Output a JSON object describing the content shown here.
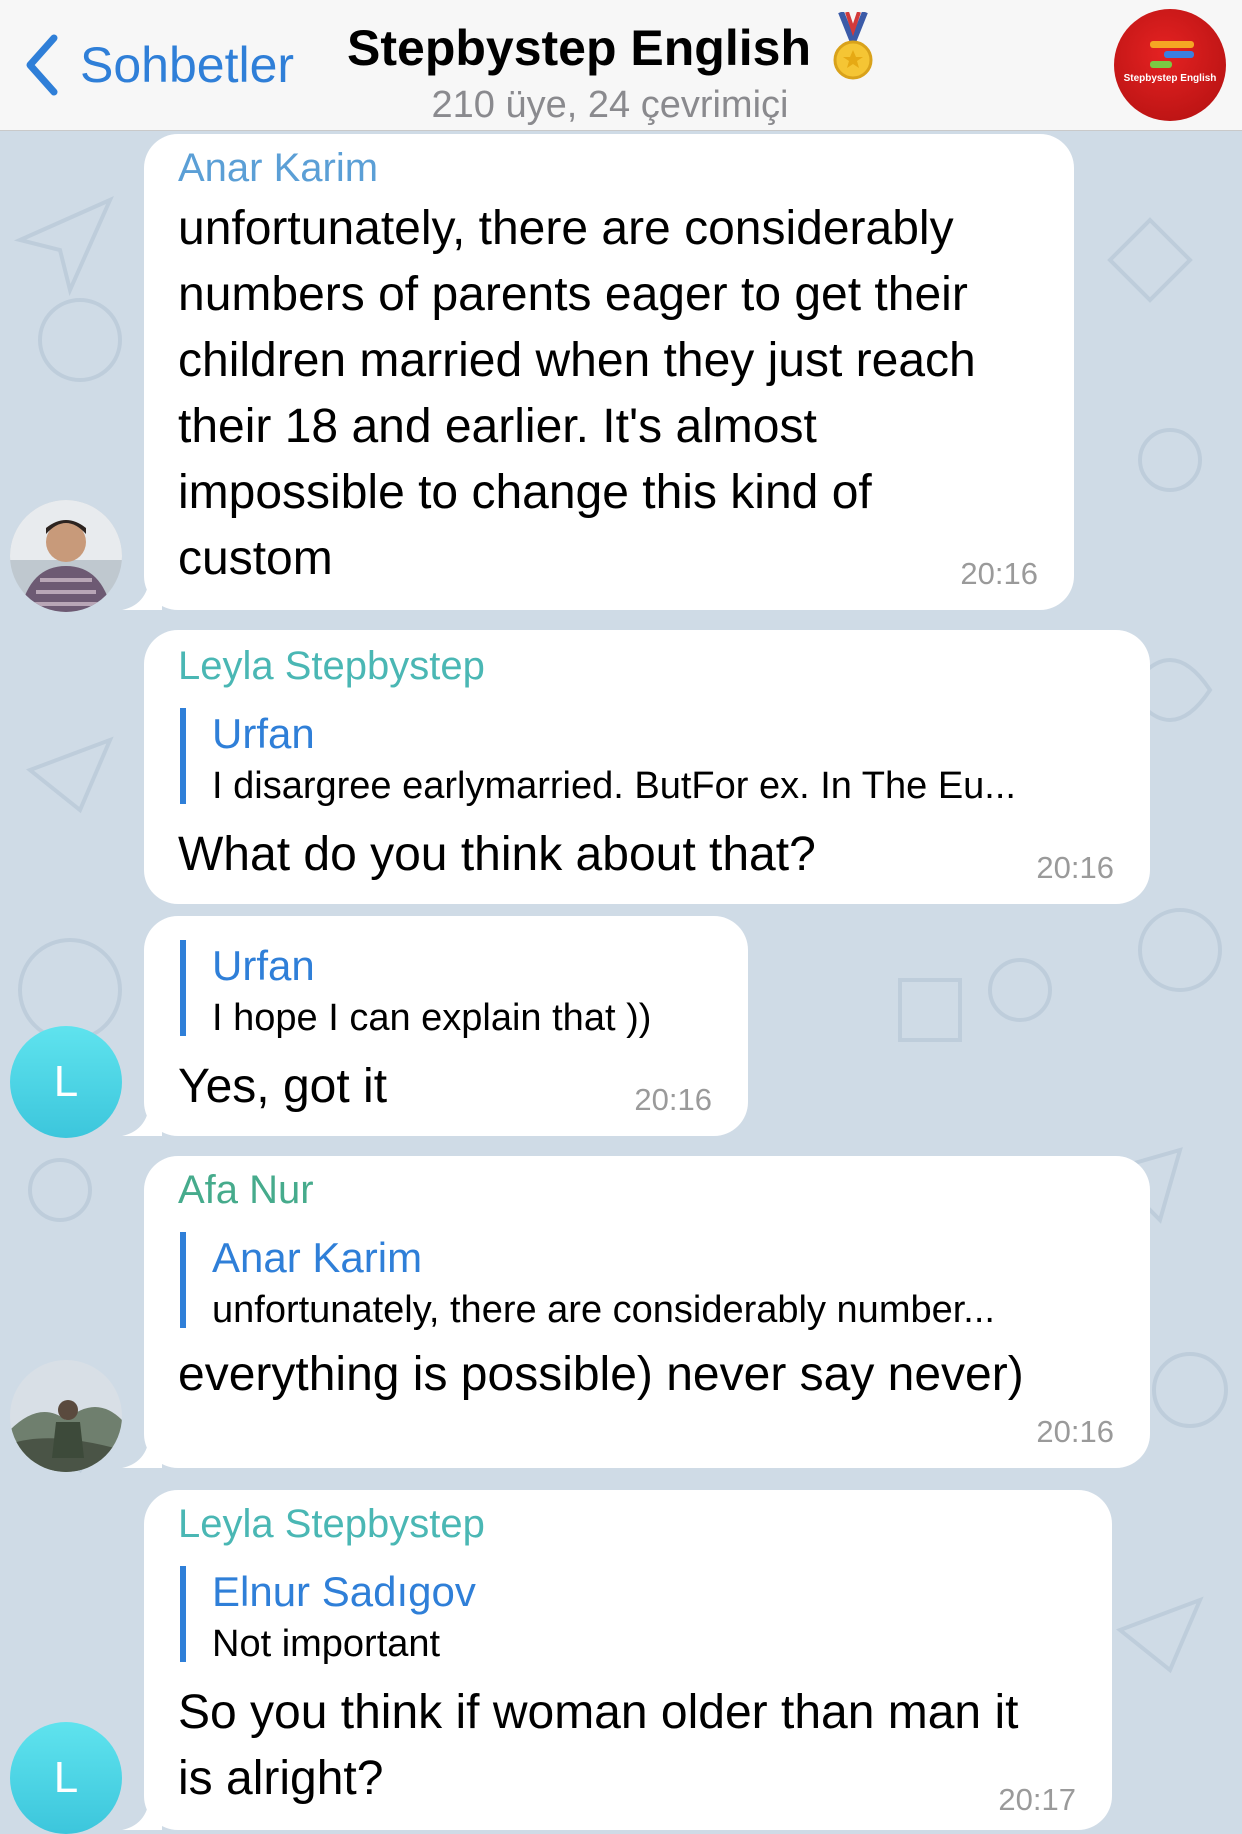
{
  "header": {
    "back_label": "Sohbetler",
    "title": "Stepbystep English",
    "subtitle": "210 üye, 24 çevrimiçi",
    "logo_text": "Stepbystep English"
  },
  "messages": [
    {
      "sender": "Anar Karim",
      "sender_color": "#5b9fd6",
      "text": "unfortunately, there are considerably\nnumbers of parents eager to get their\nchildren married when they just reach\ntheir 18 and earlier. It's almost\nimpossible to change this kind of\ncustom",
      "time": "20:16"
    },
    {
      "sender": "Leyla Stepbystep",
      "sender_color": "#4ab7b4",
      "reply": {
        "name": "Urfan",
        "text": "I disargree earlymarried. ButFor ex. In The Eu..."
      },
      "text": "What do you think about that?",
      "time": "20:16"
    },
    {
      "reply": {
        "name": "Urfan",
        "text": "I hope I can explain that ))"
      },
      "text": "Yes, got it",
      "time": "20:16",
      "avatar_letter": "L"
    },
    {
      "sender": "Afa Nur",
      "sender_color": "#46ab8c",
      "reply": {
        "name": "Anar Karim",
        "text": "unfortunately, there are considerably number..."
      },
      "text": "everything is possible) never say never)",
      "time": "20:16"
    },
    {
      "sender": "Leyla Stepbystep",
      "sender_color": "#4ab7b4",
      "reply": {
        "name": "Elnur Sadıgov",
        "text": "Not important"
      },
      "text": "So you think if woman older than man it\nis alright?",
      "time": "20:17",
      "avatar_letter": "L"
    }
  ]
}
